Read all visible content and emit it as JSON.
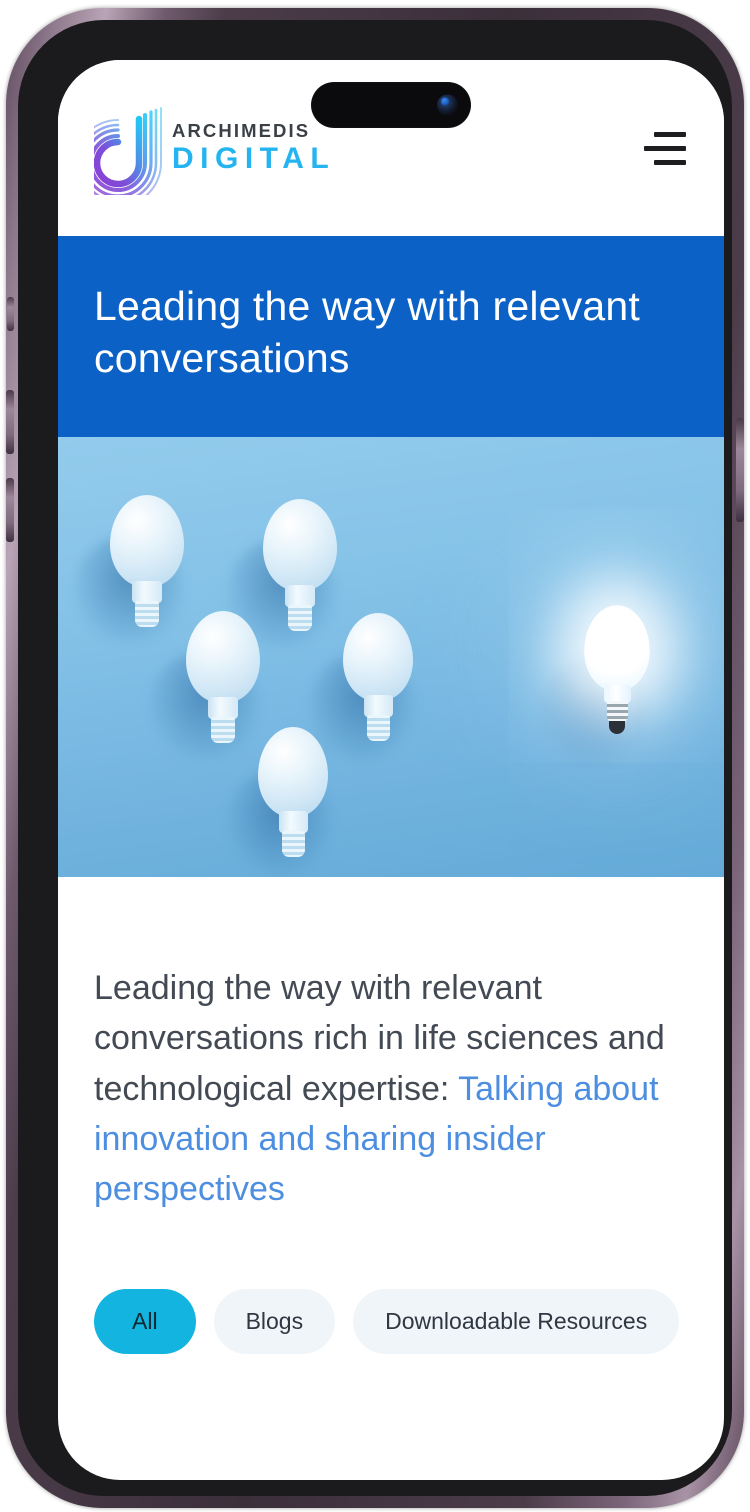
{
  "device": {
    "name": "smartphone-mockup",
    "frame_color": "#6e5a6c",
    "bezel_color": "#1b1a1c"
  },
  "header": {
    "logo_icon": "archimedis-d-logo-icon",
    "brand_line_1": "ARCHIMEDIS",
    "brand_line_2": "DIGITAL",
    "brand_line_1_color": "#3b3f46",
    "brand_line_2_color": "#24b4ef",
    "menu_icon": "hamburger-menu-icon"
  },
  "hero": {
    "title": "Leading the way with relevant conversations",
    "background_color": "#0b61c6",
    "title_color": "#ffffff",
    "image": {
      "name": "lightbulbs-idea-photo",
      "alt": "Five unlit white lightbulbs arranged in a V formation on a blue background with one glowing lightbulb separate on the right",
      "background_top_color": "#92cbec",
      "background_bottom_color": "#64aad8",
      "unlit_bulb_count": 5,
      "lit_bulb_count": 1
    }
  },
  "intro": {
    "text_plain": "Leading the way with relevant conversations rich in life sciences and technological expertise: ",
    "link_text": "Talking about innovation and sharing insider perspectives",
    "text_color": "#434a54",
    "link_color": "#4d8ee0"
  },
  "filters": {
    "active_color": "#13b4e0",
    "inactive_color": "#eff5f9",
    "items": [
      {
        "label": "All",
        "active": true
      },
      {
        "label": "Blogs",
        "active": false
      },
      {
        "label": "Downloadable Resources",
        "active": false
      }
    ]
  }
}
